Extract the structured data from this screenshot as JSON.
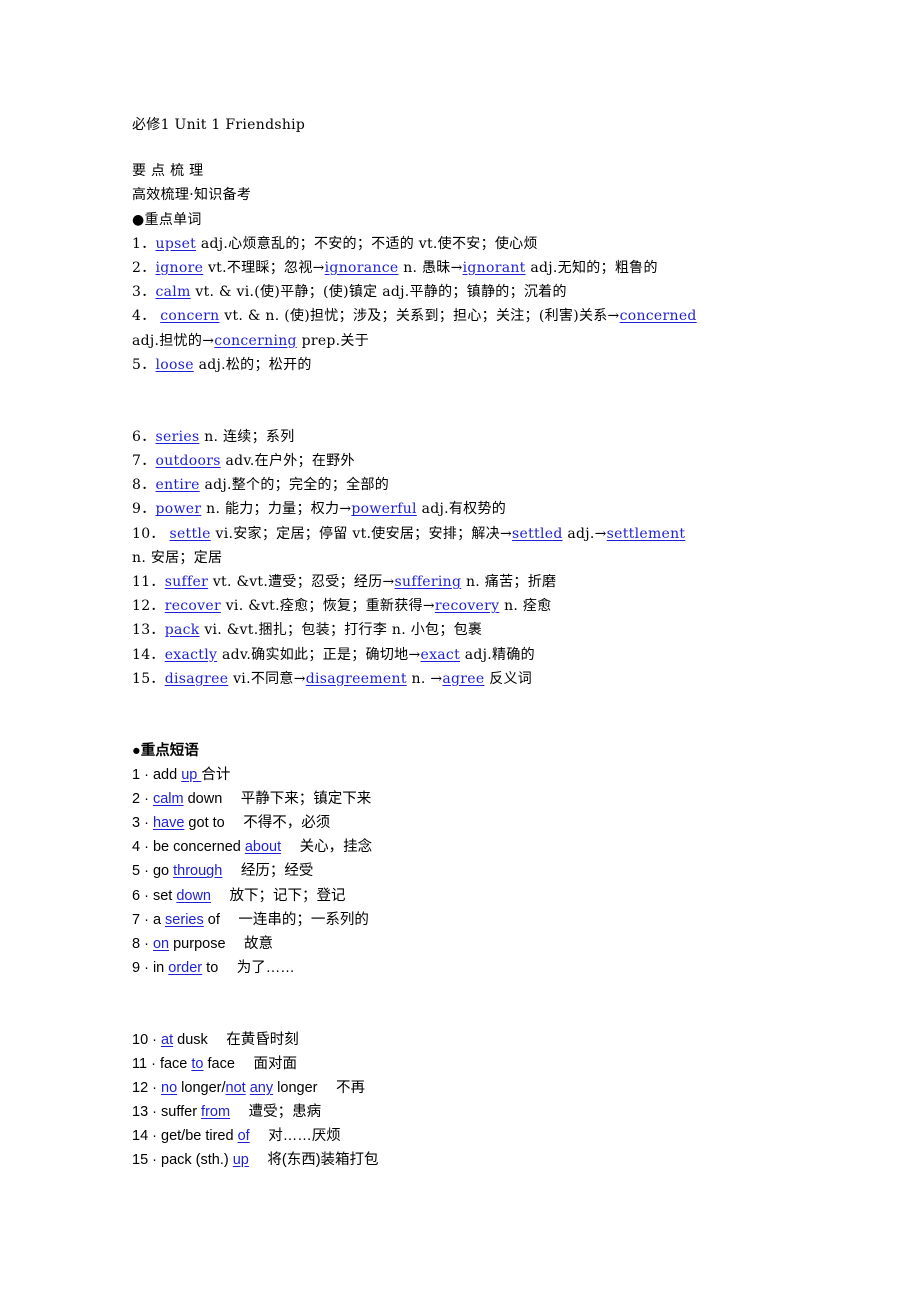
{
  "header": {
    "title": "必修1  Unit 1  Friendship",
    "section_title": "要 点 梳 理",
    "subtitle": "高效梳理·知识备考"
  },
  "words": {
    "heading": "●重点单词",
    "items": [
      {
        "num": "1．",
        "parts": [
          {
            "link": "upset"
          },
          {
            "text": " adj.心烦意乱的；不安的；不适的 vt.使不安；使心烦"
          }
        ]
      },
      {
        "num": "2．",
        "parts": [
          {
            "link": "ignore"
          },
          {
            "text": " vt.不理睬；忽视→"
          },
          {
            "link": "ignorance"
          },
          {
            "text": " n. 愚昧→"
          },
          {
            "link": "ignorant"
          },
          {
            "text": " adj.无知的；粗鲁的"
          }
        ]
      },
      {
        "num": "3．",
        "parts": [
          {
            "link": "calm"
          },
          {
            "text": " vt. & vi.(使)平静；(使)镇定  adj.平静的；镇静的；沉着的"
          }
        ]
      },
      {
        "num": "4． ",
        "parts": [
          {
            "link": "concern"
          },
          {
            "text": " vt. & n. (使)担忧；涉及；关系到；担心；关注；(利害)关系→"
          },
          {
            "link": "concerned"
          }
        ]
      },
      {
        "num": "",
        "parts": [
          {
            "text": "adj.担忧的→"
          },
          {
            "link": "concerning"
          },
          {
            "text": " prep.关于"
          }
        ]
      },
      {
        "num": "5．",
        "parts": [
          {
            "link": "loose"
          },
          {
            "text": " adj.松的；松开的"
          }
        ]
      }
    ],
    "items_2": [
      {
        "num": "6．",
        "parts": [
          {
            "link": "series"
          },
          {
            "text": " n. 连续；系列"
          }
        ]
      },
      {
        "num": "7．",
        "parts": [
          {
            "link": "outdoors"
          },
          {
            "text": " adv.在户外；在野外"
          }
        ]
      },
      {
        "num": "8．",
        "parts": [
          {
            "link": "entire"
          },
          {
            "text": " adj.整个的；完全的；全部的"
          }
        ]
      },
      {
        "num": "9．",
        "parts": [
          {
            "link": "power"
          },
          {
            "text": " n. 能力；力量；权力→"
          },
          {
            "link": "powerful"
          },
          {
            "text": " adj.有权势的"
          }
        ]
      },
      {
        "num": "10． ",
        "parts": [
          {
            "link": "settle"
          },
          {
            "text": " vi.安家；定居；停留 vt.使安居；安排；解决→"
          },
          {
            "link": "settled"
          },
          {
            "text": " adj.→"
          },
          {
            "link": "settlement"
          }
        ]
      },
      {
        "num": "",
        "parts": [
          {
            "text": "n. 安居；定居"
          }
        ]
      },
      {
        "num": "11．",
        "parts": [
          {
            "link": "suffer"
          },
          {
            "text": " vt. &vt.遭受；忍受；经历→"
          },
          {
            "link": "suffering"
          },
          {
            "text": " n. 痛苦；折磨"
          }
        ]
      },
      {
        "num": "12．",
        "parts": [
          {
            "link": "recover"
          },
          {
            "text": " vi. &vt.痊愈；恢复；重新获得→"
          },
          {
            "link": "recovery"
          },
          {
            "text": " n. 痊愈"
          }
        ]
      },
      {
        "num": "13．",
        "parts": [
          {
            "link": "pack"
          },
          {
            "text": " vi. &vt.捆扎；包装；打行李 n. 小包；包裹"
          }
        ]
      },
      {
        "num": "14．",
        "parts": [
          {
            "link": "exactly"
          },
          {
            "text": " adv.确实如此；正是；确切地→"
          },
          {
            "link": "exact"
          },
          {
            "text": " adj.精确的"
          }
        ]
      },
      {
        "num": "15．",
        "parts": [
          {
            "link": "disagree"
          },
          {
            "text": " vi.不同意→"
          },
          {
            "link": "disagreement"
          },
          {
            "text": " n. →"
          },
          {
            "link": "agree"
          },
          {
            "text": " 反义词"
          }
        ]
      }
    ]
  },
  "phrases": {
    "heading": "●重点短语",
    "items": [
      {
        "num": "1 · ",
        "parts": [
          {
            "text": "add "
          },
          {
            "link": "up "
          },
          {
            "text": "合计"
          }
        ]
      },
      {
        "num": "2 · ",
        "parts": [
          {
            "link": "calm"
          },
          {
            "text": " down　 平静下来；镇定下来"
          }
        ]
      },
      {
        "num": "3 · ",
        "parts": [
          {
            "link": "have"
          },
          {
            "text": " got to　 不得不，必须"
          }
        ]
      },
      {
        "num": "4 · ",
        "parts": [
          {
            "text": "be concerned "
          },
          {
            "link": "about"
          },
          {
            "text": "　 关心，挂念"
          }
        ]
      },
      {
        "num": "5 · ",
        "parts": [
          {
            "text": "go "
          },
          {
            "link": "through"
          },
          {
            "text": "　 经历；经受"
          }
        ]
      },
      {
        "num": "6 · ",
        "parts": [
          {
            "text": "set "
          },
          {
            "link": "down"
          },
          {
            "text": "　 放下；记下；登记"
          }
        ]
      },
      {
        "num": "7 · ",
        "parts": [
          {
            "text": "a "
          },
          {
            "link": "series"
          },
          {
            "text": " of　 一连串的；一系列的"
          }
        ]
      },
      {
        "num": "8 · ",
        "parts": [
          {
            "link": "on"
          },
          {
            "text": " purpose　 故意"
          }
        ]
      },
      {
        "num": "9 · ",
        "parts": [
          {
            "text": "in "
          },
          {
            "link": "order"
          },
          {
            "text": " to　 为了……"
          }
        ]
      }
    ],
    "items_2": [
      {
        "num": "10 · ",
        "parts": [
          {
            "link": "at"
          },
          {
            "text": " dusk　 在黄昏时刻"
          }
        ]
      },
      {
        "num": "11 · ",
        "parts": [
          {
            "text": "face "
          },
          {
            "link": "to"
          },
          {
            "text": " face　 面对面"
          }
        ]
      },
      {
        "num": "12 · ",
        "parts": [
          {
            "link": "no"
          },
          {
            "text": " longer/"
          },
          {
            "link": "not"
          },
          {
            "text": " "
          },
          {
            "link": "any"
          },
          {
            "text": " longer　 不再"
          }
        ]
      },
      {
        "num": "13 · ",
        "parts": [
          {
            "text": "suffer "
          },
          {
            "link": "from"
          },
          {
            "text": "　 遭受；患病"
          }
        ]
      },
      {
        "num": "14 · ",
        "parts": [
          {
            "text": "get/be tired "
          },
          {
            "link": "of"
          },
          {
            "text": "　 对……厌烦"
          }
        ]
      },
      {
        "num": "15 · ",
        "parts": [
          {
            "text": "pack (sth.) "
          },
          {
            "link": "up"
          },
          {
            "text": "　 将(东西)装箱打包"
          }
        ]
      }
    ]
  },
  "colors": {
    "link": "#1f1fd6",
    "text": "#000000",
    "background": "#ffffff"
  }
}
